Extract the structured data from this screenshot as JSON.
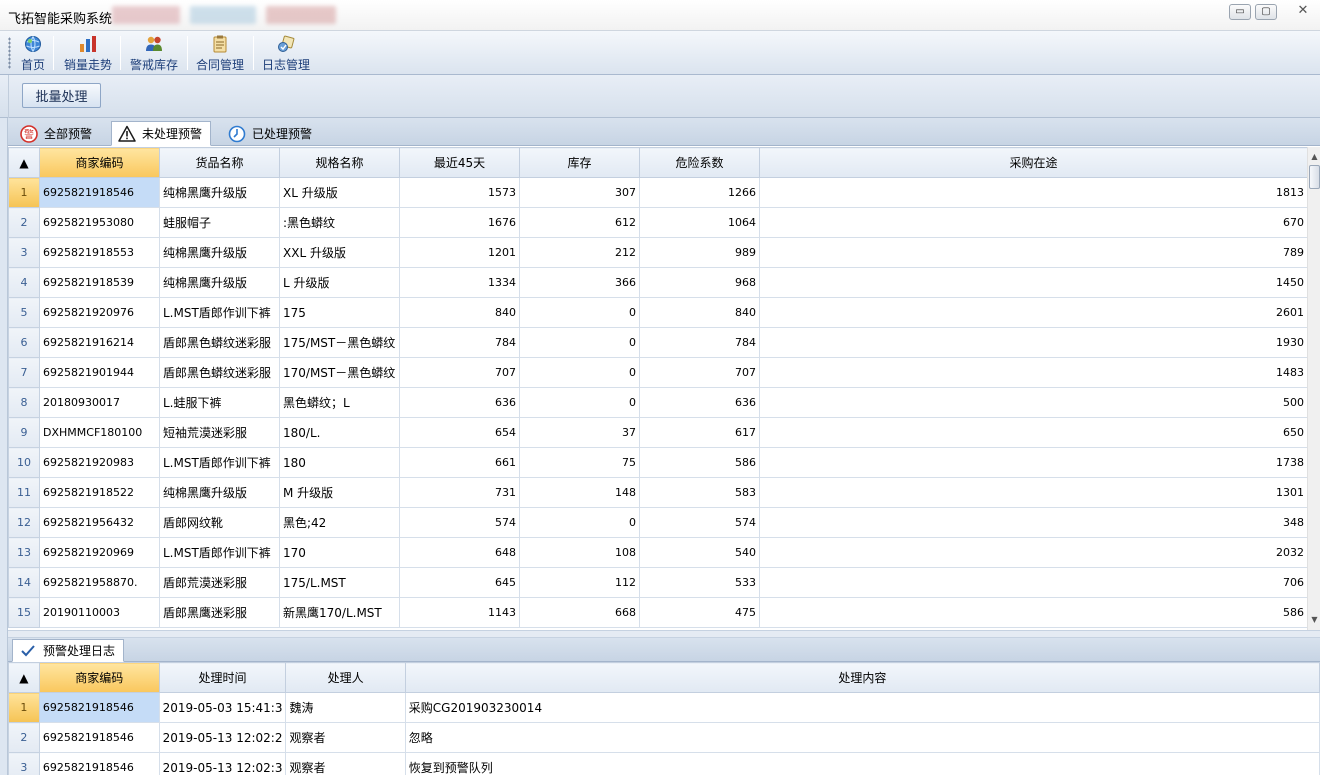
{
  "window": {
    "title": "飞拓智能采购系统",
    "controls": {
      "minimize": "▭",
      "restore": "▢",
      "close": "✕"
    }
  },
  "toolbar": {
    "items": [
      {
        "label": "首页",
        "icon": "globe-icon"
      },
      {
        "label": "销量走势",
        "icon": "bar-chart-icon"
      },
      {
        "label": "警戒库存",
        "icon": "users-icon"
      },
      {
        "label": "合同管理",
        "icon": "clipboard-icon"
      },
      {
        "label": "日志管理",
        "icon": "log-icon"
      }
    ]
  },
  "actions": {
    "batch_label": "批量处理"
  },
  "alert_tabs": [
    {
      "label": "全部预警",
      "icon": "alarm-icon"
    },
    {
      "label": "未处理预警",
      "icon": "warning-triangle-icon"
    },
    {
      "label": "已处理预警",
      "icon": "clock-check-icon"
    }
  ],
  "alert_grid": {
    "corner_glyph": "▲",
    "columns": [
      "商家编码",
      "货品名称",
      "规格名称",
      "最近45天",
      "库存",
      "危险系数",
      "采购在途"
    ],
    "rows": [
      [
        "1",
        "6925821918546",
        "纯棉黑鹰升级版",
        "XL  升级版",
        "1573",
        "307",
        "1266",
        "1813"
      ],
      [
        "2",
        "6925821953080",
        "蛙服帽子",
        ":黑色蟒纹",
        "1676",
        "612",
        "1064",
        "670"
      ],
      [
        "3",
        "6925821918553",
        "纯棉黑鹰升级版",
        "XXL  升级版",
        "1201",
        "212",
        "989",
        "789"
      ],
      [
        "4",
        "6925821918539",
        "纯棉黑鹰升级版",
        "L    升级版",
        "1334",
        "366",
        "968",
        "1450"
      ],
      [
        "5",
        "6925821920976",
        "L.MST盾郎作训下裤",
        "175",
        "840",
        "0",
        "840",
        "2601"
      ],
      [
        "6",
        "6925821916214",
        "盾郎黑色蟒纹迷彩服",
        "175/MST－黑色蟒纹",
        "784",
        "0",
        "784",
        "1930"
      ],
      [
        "7",
        "6925821901944",
        "盾郎黑色蟒纹迷彩服",
        "170/MST－黑色蟒纹",
        "707",
        "0",
        "707",
        "1483"
      ],
      [
        "8",
        "20180930017",
        "L.蛙服下裤",
        "黑色蟒纹；L",
        "636",
        "0",
        "636",
        "500"
      ],
      [
        "9",
        "DXHMMCF180100",
        "短袖荒漠迷彩服",
        "180/L.",
        "654",
        "37",
        "617",
        "650"
      ],
      [
        "10",
        "6925821920983",
        "L.MST盾郎作训下裤",
        "180",
        "661",
        "75",
        "586",
        "1738"
      ],
      [
        "11",
        "6925821918522",
        "纯棉黑鹰升级版",
        "M    升级版",
        "731",
        "148",
        "583",
        "1301"
      ],
      [
        "12",
        "6925821956432",
        "盾郎网纹靴",
        "黑色;42",
        "574",
        "0",
        "574",
        "348"
      ],
      [
        "13",
        "6925821920969",
        "L.MST盾郎作训下裤",
        "170",
        "648",
        "108",
        "540",
        "2032"
      ],
      [
        "14",
        "6925821958870.",
        "盾郎荒漠迷彩服",
        "175/L.MST",
        "645",
        "112",
        "533",
        "706"
      ],
      [
        "15",
        "20190110003",
        "盾郎黑鹰迷彩服",
        "新黑鹰170/L.MST",
        "1143",
        "668",
        "475",
        "586"
      ]
    ]
  },
  "log_tab": {
    "label": "预警处理日志",
    "icon": "checkmark-icon"
  },
  "log_grid": {
    "corner_glyph": "▲",
    "columns": [
      "商家编码",
      "处理时间",
      "处理人",
      "处理内容"
    ],
    "rows": [
      [
        "1",
        "6925821918546",
        "2019-05-03 15:41:3",
        "魏涛",
        "采购CG201903230014"
      ],
      [
        "2",
        "6925821918546",
        "2019-05-13 12:02:2",
        "观察者",
        "忽略"
      ],
      [
        "3",
        "6925821918546",
        "2019-05-13 12:02:3",
        "观察者",
        "恢复到预警队列"
      ]
    ]
  },
  "scroll": {
    "up": "▲",
    "down": "▼"
  }
}
